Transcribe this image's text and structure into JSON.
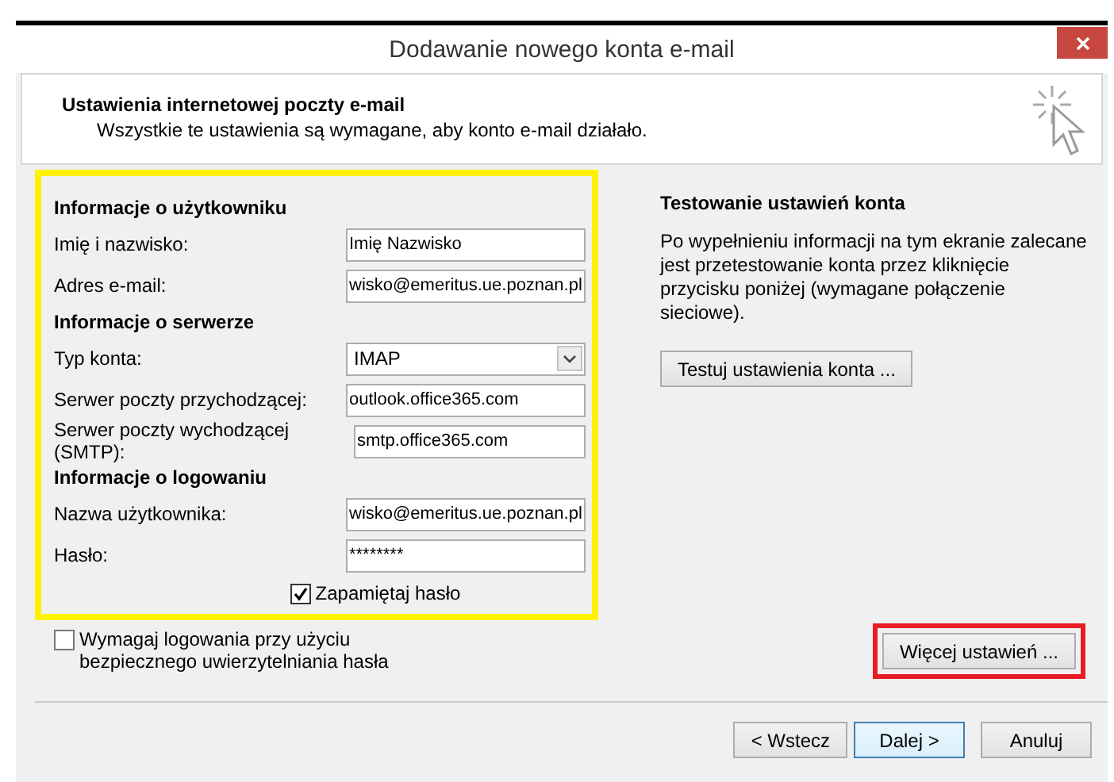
{
  "window": {
    "title": "Dodawanie nowego konta e-mail"
  },
  "header": {
    "title": "Ustawienia internetowej poczty e-mail",
    "subtitle": "Wszystkie te ustawienia są wymagane, aby konto e-mail działało."
  },
  "form": {
    "highlight": {
      "color": "#fff200"
    },
    "sections": [
      {
        "heading": "Informacje o użytkowniku",
        "fields": [
          {
            "label": "Imię i nazwisko:",
            "value": "Imię Nazwisko",
            "kind": "text"
          },
          {
            "label": "Adres e-mail:",
            "value": "wisko@emeritus.ue.poznan.pl",
            "kind": "text"
          }
        ]
      },
      {
        "heading": "Informacje o serwerze",
        "fields": [
          {
            "label": "Typ konta:",
            "value": "IMAP",
            "kind": "dropdown"
          },
          {
            "label": "Serwer poczty przychodzącej:",
            "value": "outlook.office365.com",
            "kind": "text"
          },
          {
            "label": "Serwer poczty wychodzącej (SMTP):",
            "value": "smtp.office365.com",
            "kind": "text"
          }
        ]
      },
      {
        "heading": "Informacje o logowaniu",
        "fields": [
          {
            "label": "Nazwa użytkownika:",
            "value": "wisko@emeritus.ue.poznan.pl",
            "kind": "text"
          },
          {
            "label": "Hasło:",
            "value": "********",
            "kind": "password"
          }
        ]
      }
    ],
    "remember_password": {
      "label": "Zapamiętaj hasło",
      "checked": true
    }
  },
  "secure_auth": {
    "label": "Wymagaj logowania przy użyciu bezpiecznego uwierzytelniania hasła",
    "checked": false
  },
  "test": {
    "heading": "Testowanie ustawień konta",
    "description": "Po wypełnieniu informacji na tym ekranie zalecane jest przetestowanie konta przez kliknięcie przycisku poniżej (wymagane połączenie sieciowe).",
    "button": "Testuj ustawienia konta ..."
  },
  "more_settings": {
    "label": "Więcej ustawień ...",
    "highlight": {
      "color": "#e81c24"
    }
  },
  "footer_buttons": [
    {
      "label": "< Wstecz",
      "focused": false
    },
    {
      "label": "Dalej >",
      "focused": true
    },
    {
      "label": "Anuluj",
      "focused": false
    }
  ]
}
